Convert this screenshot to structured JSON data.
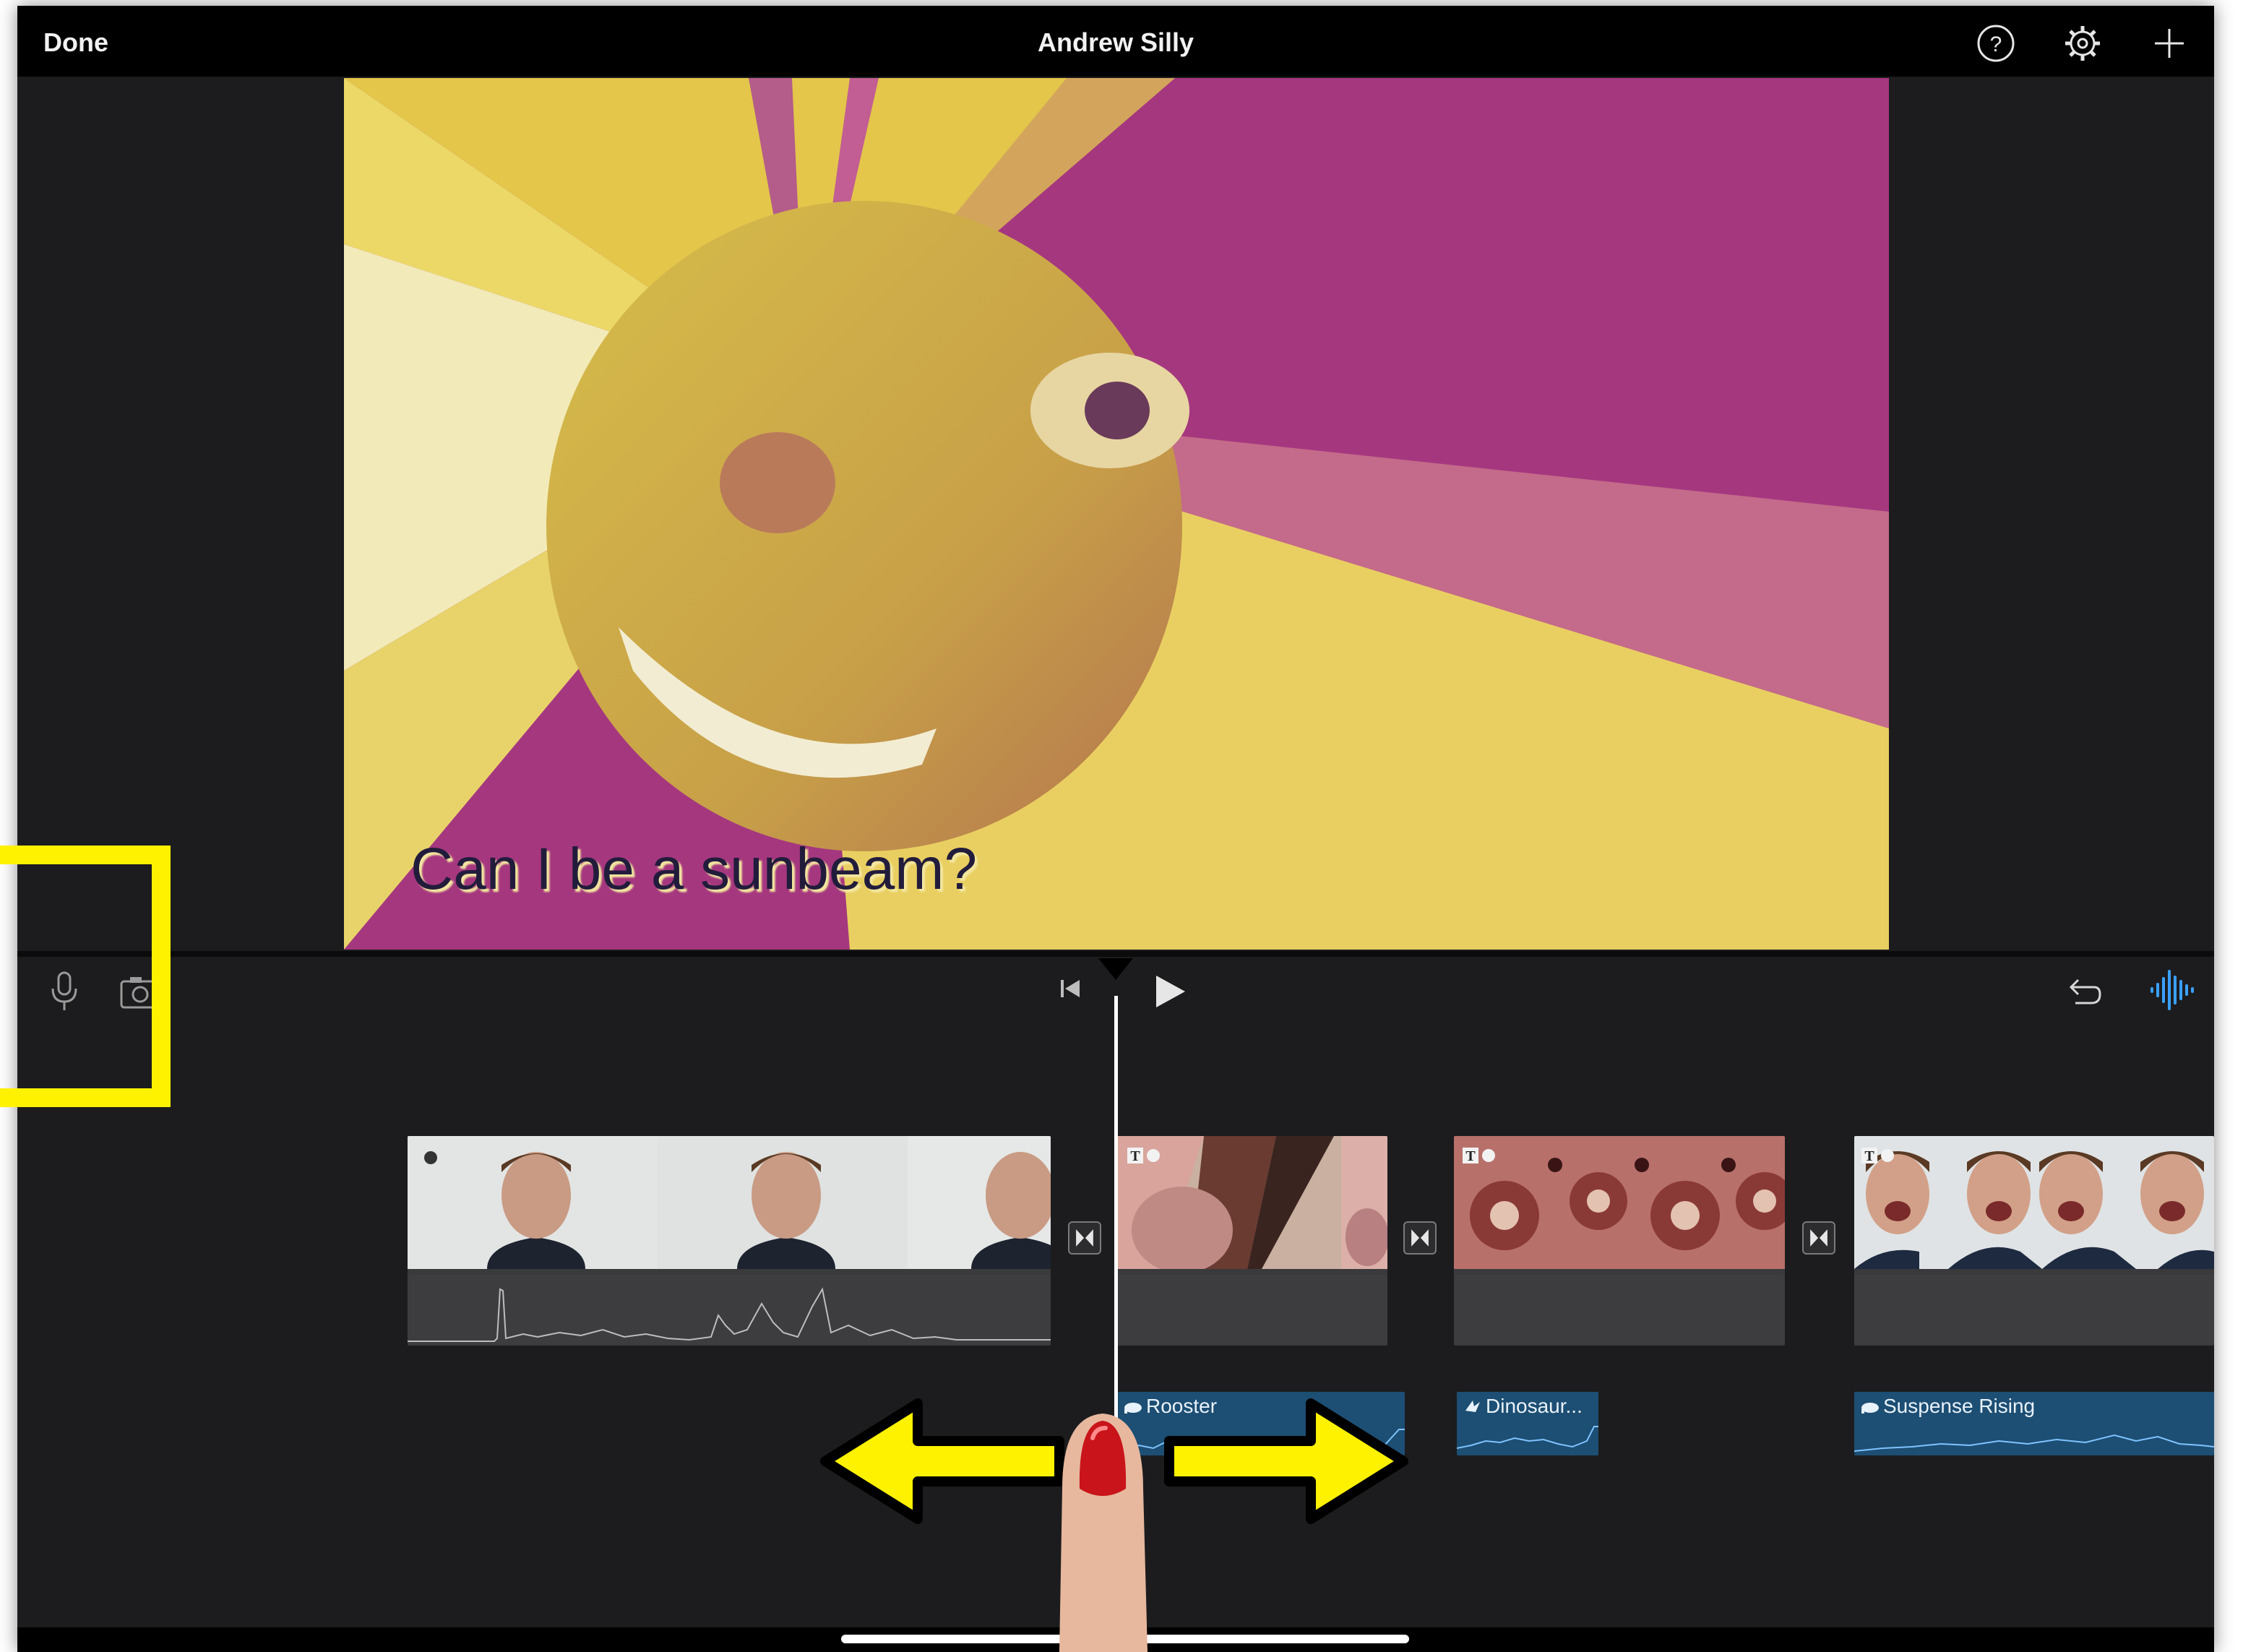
{
  "app": {
    "done_label": "Done",
    "title": "Andrew Silly"
  },
  "toolbar_icons": [
    "help-icon",
    "settings-icon",
    "add-icon"
  ],
  "preview": {
    "caption": "Can I be a sunbeam?"
  },
  "timeline_controls": [
    "microphone-icon",
    "camera-icon",
    "skip-to-start-icon",
    "play-icon",
    "undo-icon",
    "audio-waveform-icon"
  ],
  "clips": [
    {
      "name": "clip-selfie-smiling"
    },
    {
      "name": "clip-sunbeam",
      "has_title": true
    },
    {
      "name": "clip-kaleidoscope",
      "has_title": true
    },
    {
      "name": "clip-mirror-faces",
      "has_title": true
    }
  ],
  "music": {
    "track1": "Rooster",
    "track2": "Dinosaur...",
    "track3": "Suspense Rising"
  },
  "colors": {
    "annotation_yellow": "#fff200",
    "music_track": "#1d4e73",
    "accent_blue": "#3aa0ff"
  }
}
